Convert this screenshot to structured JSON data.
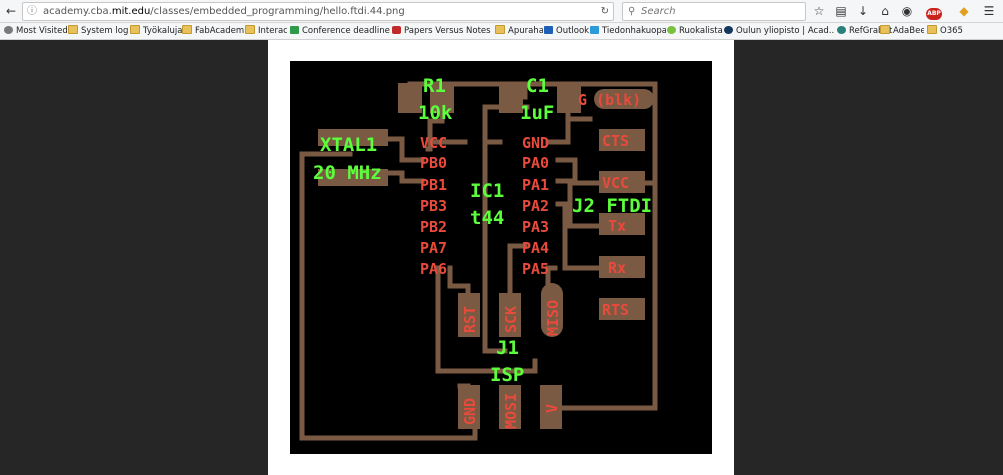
{
  "browser": {
    "url_prefix": "academy.cba.",
    "url_domain": "mit.edu",
    "url_suffix": "/classes/embedded_programming/hello.ftdi.44.png",
    "search_placeholder": "Search",
    "back_icon": "back-arrow-icon",
    "abp_badge": "ABP"
  },
  "bookmarks": [
    {
      "label": "Most Visited",
      "icon": "gear-icon"
    },
    {
      "label": "System login",
      "icon": "folder-icon"
    },
    {
      "label": "Työkaluja",
      "icon": "folder-icon"
    },
    {
      "label": "FabAcademy",
      "icon": "folder-icon"
    },
    {
      "label": "Interact",
      "icon": "folder-icon"
    },
    {
      "label": "Conference deadlines ...",
      "icon": "calendar-icon"
    },
    {
      "label": "Papers Versus Notes -...",
      "icon": "cs-icon"
    },
    {
      "label": "Apurahat",
      "icon": "folder-icon"
    },
    {
      "label": "Outlook",
      "icon": "outlook-icon"
    },
    {
      "label": "Tiedonhakuopas",
      "icon": "library-icon"
    },
    {
      "label": "Ruokalistat",
      "icon": "leaf-icon"
    },
    {
      "label": "Oulun yliopisto | Acad...",
      "icon": "university-icon"
    },
    {
      "label": "RefGrab-It",
      "icon": "refgrab-icon"
    },
    {
      "label": "AdaBee",
      "icon": "adabee-icon"
    },
    {
      "label": "O365",
      "icon": "folder-icon"
    }
  ],
  "board": {
    "components": {
      "r1": "R1",
      "r1_value": "10k",
      "c1": "C1",
      "c1_value": "1uF",
      "xtal": "XTAL1",
      "xtal_value": "20 MHz",
      "ic": "IC1",
      "ic_value": "t44",
      "ftdi": "J2 FTDI",
      "isp": "J1",
      "isp_value": "ISP"
    },
    "pins": {
      "vcc_left": "VCC",
      "pb0": "PB0",
      "pb1": "PB1",
      "pb3": "PB3",
      "pb2": "PB2",
      "pa7": "PA7",
      "pa6": "PA6",
      "gnd_ic": "GND",
      "pa0": "PA0",
      "pa1": "PA1",
      "pa2": "PA2",
      "pa3": "PA3",
      "pa4": "PA4",
      "pa5": "PA5",
      "g_blk": "G (blk)",
      "cts": "CTS",
      "vcc_ftdi": "VCC",
      "tx": "Tx",
      "rx": "Rx",
      "rts": "RTS",
      "rst": "RST",
      "sck": "SCK",
      "miso": "MISO",
      "gnd_isp": "GND",
      "mosi": "MOSI",
      "v": "V"
    },
    "colors": {
      "background": "#000000",
      "copper": "#7a5a43",
      "pin_text": "#e84a3c",
      "label_text": "#5cff3c"
    }
  }
}
